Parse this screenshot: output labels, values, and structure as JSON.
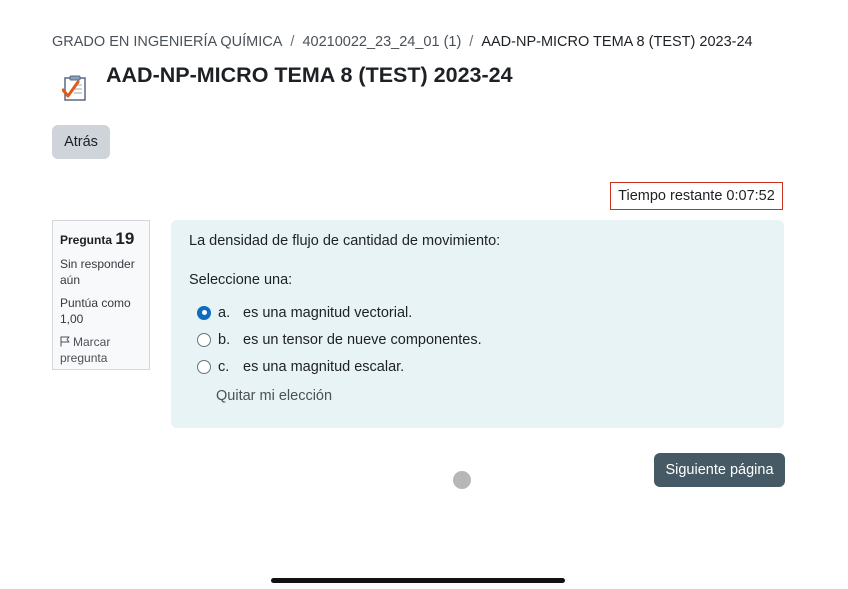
{
  "breadcrumb": {
    "items": [
      "GRADO EN INGENIERÍA QUÍMICA",
      "40210022_23_24_01 (1)",
      "AAD-NP-MICRO TEMA 8 (TEST) 2023-24"
    ],
    "separator": "/"
  },
  "header": {
    "title": "AAD-NP-MICRO TEMA 8 (TEST) 2023-24",
    "icon": "quiz-icon"
  },
  "navigation": {
    "back_label": "Atrás",
    "next_label": "Siguiente página"
  },
  "timer": {
    "label": "Tiempo restante 0:07:52"
  },
  "question_info": {
    "label": "Pregunta",
    "number": "19",
    "state": "Sin responder aún",
    "grade": "Puntúa como 1,00",
    "flag_label": "Marcar pregunta",
    "flag_icon": "flag-icon"
  },
  "question": {
    "text": "La densidad de flujo de cantidad de movimiento:",
    "prompt": "Seleccione una:",
    "answers": [
      {
        "letter": "a.",
        "text": "es una magnitud vectorial.",
        "selected": true
      },
      {
        "letter": "b.",
        "text": "es un tensor de nueve componentes.",
        "selected": false
      },
      {
        "letter": "c.",
        "text": "es una magnitud escalar.",
        "selected": false
      }
    ],
    "clear_choice_label": "Quitar mi elección"
  },
  "colors": {
    "accent": "#0f6cbf",
    "question_bg": "#e7f3f5",
    "next_button_bg": "#465a65",
    "timer_border": "#ca3120",
    "back_button_bg": "#ced4da"
  }
}
